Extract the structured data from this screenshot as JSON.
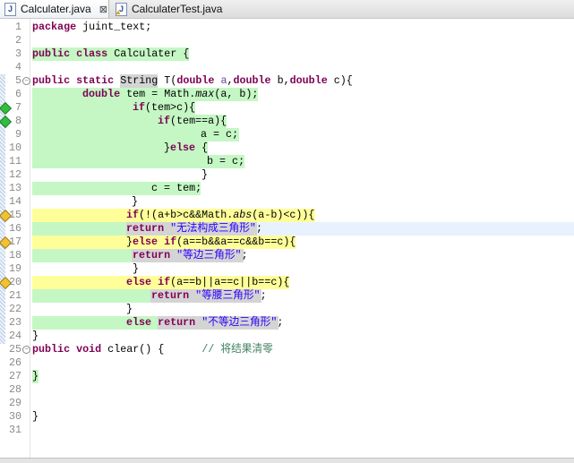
{
  "tabs": [
    {
      "label": "Calculater.java",
      "active": true,
      "icon": "java-file-icon",
      "close": "⊠"
    },
    {
      "label": "CalculaterTest.java",
      "active": false,
      "icon": "java-file-warning-icon"
    }
  ],
  "colors": {
    "covered": "#c4f7c4",
    "partial": "#ffff99",
    "current_line": "#e8f2fe",
    "occurrence": "#d4d4d4"
  },
  "editor": {
    "line_numbers": [
      "1",
      "2",
      "3",
      "4",
      "5",
      "6",
      "7",
      "8",
      "9",
      "10",
      "11",
      "12",
      "13",
      "14",
      "15",
      "16",
      "17",
      "18",
      "19",
      "20",
      "21",
      "22",
      "23",
      "24",
      "25",
      "26",
      "27",
      "28",
      "29",
      "30",
      "31"
    ],
    "lines": [
      {
        "n": 1,
        "tokens": [
          {
            "t": "package",
            "k": "kw"
          },
          {
            "t": " juint_text;"
          }
        ]
      },
      {
        "n": 3,
        "tokens": [
          {
            "t": "public",
            "k": "kw"
          },
          {
            "t": " "
          },
          {
            "t": "class",
            "k": "kw"
          },
          {
            "t": " Calculater {"
          }
        ]
      },
      {
        "n": 5,
        "tokens": [
          {
            "t": "public",
            "k": "kw"
          },
          {
            "t": " "
          },
          {
            "t": "static",
            "k": "kw"
          },
          {
            "t": " String T("
          },
          {
            "t": "double",
            "k": "kw"
          },
          {
            "t": " a",
            "k": "var"
          },
          {
            "t": ","
          },
          {
            "t": "double",
            "k": "kw"
          },
          {
            "t": " b,"
          },
          {
            "t": "double",
            "k": "kw"
          },
          {
            "t": " c){"
          }
        ]
      },
      {
        "n": 6,
        "tokens": [
          {
            "t": "double",
            "k": "kw"
          },
          {
            "t": " tem = Math."
          },
          {
            "t": "max",
            "k": "it"
          },
          {
            "t": "(a, b);"
          }
        ]
      },
      {
        "n": 7,
        "tokens": [
          {
            "t": "if",
            "k": "kw"
          },
          {
            "t": "(tem>c){"
          }
        ]
      },
      {
        "n": 8,
        "tokens": [
          {
            "t": "if",
            "k": "kw"
          },
          {
            "t": "(tem==a){"
          }
        ]
      },
      {
        "n": 9,
        "tokens": [
          {
            "t": "a = c;"
          }
        ]
      },
      {
        "n": 10,
        "tokens": [
          {
            "t": "}"
          },
          {
            "t": "else",
            "k": "kw"
          },
          {
            "t": " {"
          }
        ]
      },
      {
        "n": 11,
        "tokens": [
          {
            "t": "b = c;"
          }
        ]
      },
      {
        "n": 12,
        "tokens": [
          {
            "t": "}"
          }
        ]
      },
      {
        "n": 13,
        "tokens": [
          {
            "t": "c = tem;"
          }
        ]
      },
      {
        "n": 14,
        "tokens": [
          {
            "t": "}"
          }
        ]
      },
      {
        "n": 15,
        "tokens": [
          {
            "t": "if",
            "k": "kw"
          },
          {
            "t": "(!(a+b>c&&Math."
          },
          {
            "t": "abs",
            "k": "it"
          },
          {
            "t": "(a-b)<c)){"
          }
        ]
      },
      {
        "n": 16,
        "tokens": [
          {
            "t": "return",
            "k": "kw"
          },
          {
            "t": " "
          },
          {
            "t": "\"无法构成三角形\"",
            "k": "str"
          },
          {
            "t": ";"
          }
        ]
      },
      {
        "n": 17,
        "tokens": [
          {
            "t": "}"
          },
          {
            "t": "else",
            "k": "kw"
          },
          {
            "t": " "
          },
          {
            "t": "if",
            "k": "kw"
          },
          {
            "t": "(a==b&&a==c&&b==c){"
          }
        ]
      },
      {
        "n": 18,
        "tokens": [
          {
            "t": "return",
            "k": "kw"
          },
          {
            "t": " "
          },
          {
            "t": "\"等边三角形\"",
            "k": "str"
          },
          {
            "t": ";"
          }
        ]
      },
      {
        "n": 19,
        "tokens": [
          {
            "t": "}"
          }
        ]
      },
      {
        "n": 20,
        "tokens": [
          {
            "t": "else",
            "k": "kw"
          },
          {
            "t": " "
          },
          {
            "t": "if",
            "k": "kw"
          },
          {
            "t": "(a==b||a==c||b==c){"
          }
        ]
      },
      {
        "n": 21,
        "tokens": [
          {
            "t": "return",
            "k": "kw"
          },
          {
            "t": " "
          },
          {
            "t": "\"等腰三角形\"",
            "k": "str"
          },
          {
            "t": ";"
          }
        ]
      },
      {
        "n": 22,
        "tokens": [
          {
            "t": "}"
          }
        ]
      },
      {
        "n": 23,
        "tokens": [
          {
            "t": "else",
            "k": "kw"
          },
          {
            "t": " "
          },
          {
            "t": "return",
            "k": "kw"
          },
          {
            "t": " "
          },
          {
            "t": "\"不等边三角形\"",
            "k": "str"
          },
          {
            "t": ";"
          }
        ]
      },
      {
        "n": 24,
        "tokens": [
          {
            "t": "}"
          }
        ]
      },
      {
        "n": 25,
        "tokens": [
          {
            "t": "public",
            "k": "kw"
          },
          {
            "t": " "
          },
          {
            "t": "void",
            "k": "kw"
          },
          {
            "t": " clear() {      "
          },
          {
            "t": "// 将结果清零",
            "k": "cmt"
          }
        ]
      },
      {
        "n": 27,
        "tokens": [
          {
            "t": "}"
          }
        ]
      },
      {
        "n": 30,
        "tokens": [
          {
            "t": "}"
          }
        ]
      }
    ],
    "markers": [
      {
        "line": 7,
        "type": "covered-branch",
        "color": "#2fbf3f"
      },
      {
        "line": 8,
        "type": "covered-branch",
        "color": "#2fbf3f"
      },
      {
        "line": 15,
        "type": "partial-branch",
        "color": "#f2c230"
      },
      {
        "line": 17,
        "type": "partial-branch",
        "color": "#f2c230"
      },
      {
        "line": 20,
        "type": "partial-branch",
        "color": "#f2c230"
      }
    ],
    "folds": [
      5,
      25
    ]
  }
}
